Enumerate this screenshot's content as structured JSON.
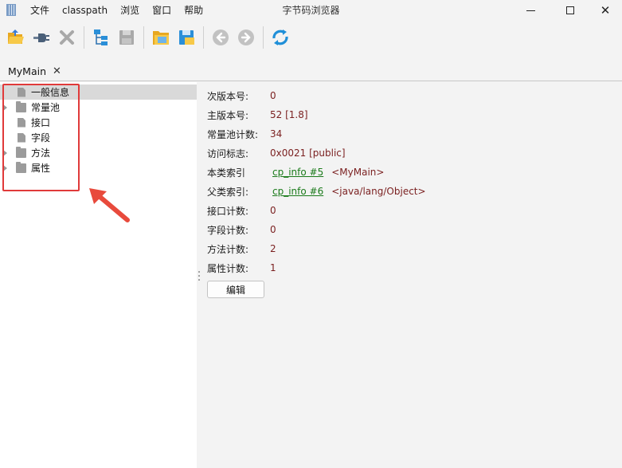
{
  "window": {
    "title": "字节码浏览器",
    "menu": [
      "文件",
      "classpath",
      "浏览",
      "窗口",
      "帮助"
    ]
  },
  "toolbar": {
    "buttons": [
      {
        "icon": "open-folder-icon"
      },
      {
        "icon": "plug-icon"
      },
      {
        "icon": "close-x-icon"
      },
      {
        "icon": "hierarchy-icon"
      },
      {
        "icon": "save-icon"
      },
      {
        "icon": "open-classpath-icon"
      },
      {
        "icon": "save-classpath-icon"
      },
      {
        "icon": "back-arrow-icon"
      },
      {
        "icon": "forward-arrow-icon"
      },
      {
        "icon": "refresh-sync-icon"
      }
    ]
  },
  "tabs": [
    {
      "label": "MyMain",
      "close": "✕"
    }
  ],
  "tree": {
    "items": [
      {
        "label": "一般信息",
        "type": "file",
        "expandable": false,
        "selected": true
      },
      {
        "label": "常量池",
        "type": "folder",
        "expandable": true,
        "selected": false
      },
      {
        "label": "接口",
        "type": "file",
        "expandable": false,
        "selected": false
      },
      {
        "label": "字段",
        "type": "file",
        "expandable": false,
        "selected": false
      },
      {
        "label": "方法",
        "type": "folder",
        "expandable": true,
        "selected": false
      },
      {
        "label": "属性",
        "type": "folder",
        "expandable": true,
        "selected": false
      }
    ]
  },
  "details": {
    "fields": [
      {
        "label": "次版本号:",
        "value": "0"
      },
      {
        "label": "主版本号:",
        "value": "52 [1.8]"
      },
      {
        "label": "常量池计数:",
        "value": "34"
      },
      {
        "label": "访问标志:",
        "value": "0x0021 [public]"
      },
      {
        "label": "本类索引",
        "link": "cp_info #5",
        "desc": "<MyMain>"
      },
      {
        "label": "父类索引:",
        "link": "cp_info #6",
        "desc": "<java/lang/Object>"
      },
      {
        "label": "接口计数:",
        "value": "0"
      },
      {
        "label": "字段计数:",
        "value": "0"
      },
      {
        "label": "方法计数:",
        "value": "2"
      },
      {
        "label": "属性计数:",
        "value": "1"
      }
    ],
    "edit_button": "编辑"
  },
  "colors": {
    "highlight": "#e03a3a",
    "value_text": "#7a1f1f",
    "link_text": "#1a7a1a",
    "selection": "#d9d9d9"
  }
}
